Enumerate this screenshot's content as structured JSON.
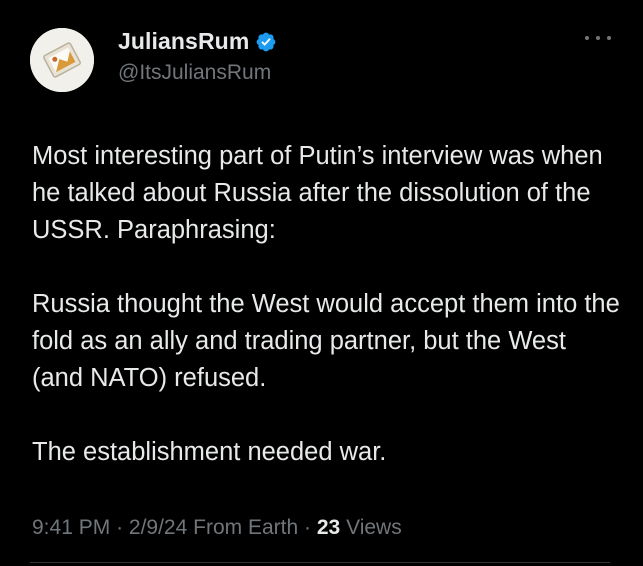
{
  "author": {
    "display_name": "JuliansRum",
    "handle": "@ItsJuliansRum",
    "verified": true
  },
  "tweet": {
    "paragraphs": [
      "Most interesting part of Putin’s interview was when he talked about Russia after the dissolution of the USSR. Paraphrasing:",
      "Russia thought the West would accept them into the fold as an ally and trading partner, but the West (and NATO) refused.",
      "The establishment needed war."
    ],
    "time": "9:41 PM",
    "date": "2/9/24",
    "source": "From Earth",
    "views_count": "23",
    "views_label": "Views",
    "separator": "·"
  },
  "colors": {
    "background": "#000000",
    "text_primary": "#e7e9ea",
    "text_secondary": "#71767b",
    "verified_badge": "#1d9bf0"
  },
  "icons": {
    "verified": "verified-badge-icon",
    "more": "more-options-icon"
  }
}
